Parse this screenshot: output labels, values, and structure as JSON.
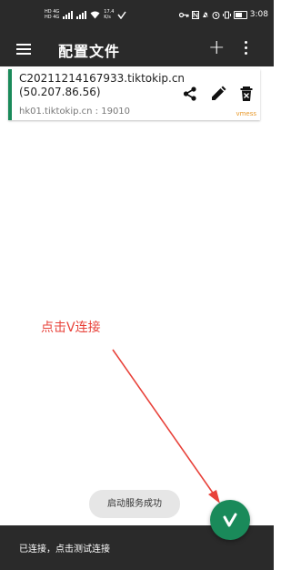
{
  "status_bar": {
    "sim1": "HD 4G",
    "sim2": "HD 4G",
    "speed_value": "17.4",
    "speed_unit": "K/s",
    "time": "3:08"
  },
  "app_bar": {
    "title": "配置文件",
    "menu_icon": "menu-icon",
    "add_icon": "plus-icon",
    "more_icon": "more-vert-icon"
  },
  "servers": [
    {
      "remark": "C20211214167933.tiktokip.cn(50.207.86.56)",
      "address": "hk01.tiktokip.cn : 19010",
      "type": "vmess",
      "selected": true
    }
  ],
  "annotation": {
    "text": "点击V连接",
    "color": "#e8423a"
  },
  "toast": {
    "text": "启动服务成功"
  },
  "bottom_bar": {
    "status_text": "已连接，点击测试连接"
  },
  "colors": {
    "accent": "#1a8a5a",
    "toolbar": "#2a2a2a",
    "protocol_label": "#e89a2c"
  }
}
